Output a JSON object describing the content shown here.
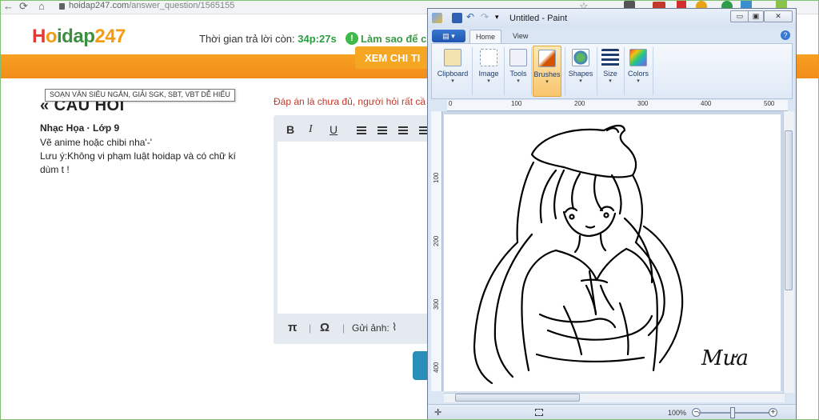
{
  "browser": {
    "url_domain": "hoidap247.com",
    "url_path": "/answer_question/1565155"
  },
  "site": {
    "logo": {
      "h": "H",
      "o": "o",
      "rest": "idap",
      "num": "247"
    },
    "timer_label": "Thời gian trả lời còn:",
    "timer_value": "34p:27s",
    "howto": "Làm sao để có",
    "xem_label": "XEM CHI TI",
    "tooltip": "SOẠN VĂN SIÊU NGẮN, GIẢI SGK, SBT, VBT DỄ HIỂU",
    "question_title": "« CÂU HỎI",
    "subject": "Nhạc Họa · Lớp 9",
    "line1": "Vẽ anime hoặc chibi nha'-'",
    "line2": "Lưu ý:Không vi phạm luật hoidap và có chữ kí dùm t !",
    "answer_note": "Đáp án là chưa đủ, người hỏi rất cầ",
    "editor": {
      "bold": "B",
      "italic": "I",
      "underline": "U",
      "pi": "π",
      "omega": "Ω",
      "send_image": "Gửi ảnh:"
    }
  },
  "paint": {
    "title": "Untitled - Paint",
    "file_menu": "▤ ▾",
    "tabs": [
      "Home",
      "View"
    ],
    "help": "?",
    "groups": [
      {
        "label": "Clipboard"
      },
      {
        "label": "Image"
      },
      {
        "label": "Tools"
      },
      {
        "label": "Brushes"
      },
      {
        "label": "Shapes"
      },
      {
        "label": "Size"
      },
      {
        "label": "Colors"
      }
    ],
    "ruler_h": [
      "0",
      "100",
      "200",
      "300",
      "400",
      "500"
    ],
    "ruler_v": [
      "100",
      "200",
      "300",
      "400"
    ],
    "signature": "Mưa",
    "zoom": "100%",
    "window_buttons": {
      "min": "▭",
      "max": "▣",
      "close": "✕"
    }
  }
}
